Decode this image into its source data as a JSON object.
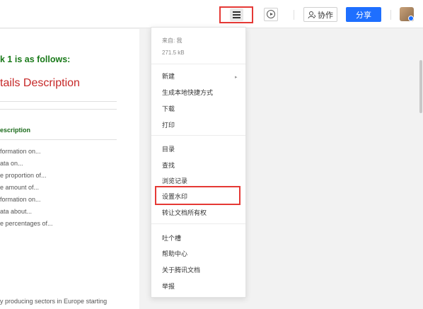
{
  "toolbar": {
    "collab_label": "协作",
    "share_label": "分享"
  },
  "doc": {
    "heading": "k 1 is as follows:",
    "subtitle": "tails Description",
    "section": "escription",
    "lines": [
      "formation on...",
      "ata on...",
      "e proportion of...",
      "e amount of...",
      "formation on...",
      "ata about...",
      "e percentages of..."
    ],
    "bottom": "y producing sectors in Europe starting"
  },
  "menu": {
    "source_label": "来自: 我",
    "file_size": "271.5 kB",
    "groups": [
      [
        "新建",
        "生成本地快捷方式",
        "下载",
        "打印"
      ],
      [
        "目录",
        "查找",
        "浏览记录",
        "设置水印",
        "转让文档所有权"
      ],
      [
        "吐个槽",
        "帮助中心",
        "关于腾讯文档",
        "举报"
      ]
    ],
    "highlighted_item": "设置水印"
  },
  "colors": {
    "accent": "#1e6fff",
    "highlight_border": "#e53935",
    "heading_green": "#1a7a1a",
    "subtitle_red": "#c62828"
  },
  "icons": [
    "menu-icon",
    "play-icon",
    "user-icon",
    "chevron-right-icon"
  ]
}
